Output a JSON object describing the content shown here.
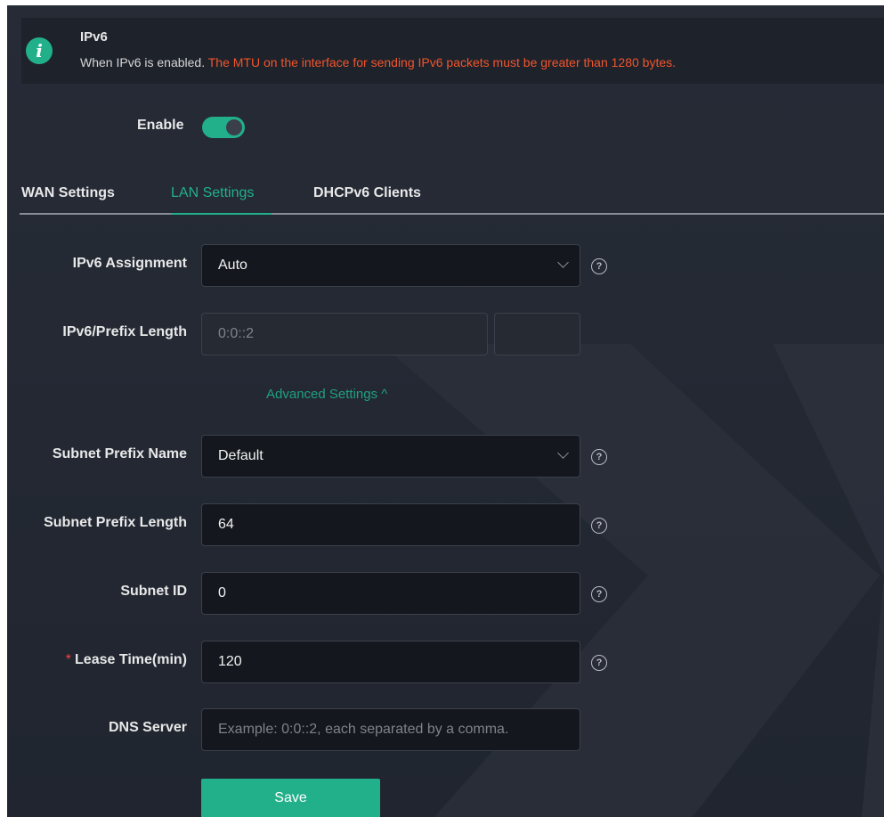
{
  "notice": {
    "title": "IPv6",
    "text_normal": "When IPv6 is enabled.",
    "text_warning": "The MTU on the interface for sending IPv6 packets must be greater than 1280 bytes.",
    "icon": "info-icon",
    "warning_color": "#f2552c"
  },
  "enable": {
    "label": "Enable",
    "state": true,
    "accent_color": "#22b08a"
  },
  "tabs": [
    {
      "label": "WAN Settings",
      "active": false
    },
    {
      "label": "LAN Settings",
      "active": true
    },
    {
      "label": "DHCPv6 Clients",
      "active": false
    }
  ],
  "form": {
    "ipv6_assignment": {
      "label": "IPv6 Assignment",
      "value": "Auto"
    },
    "prefix_length": {
      "label": "IPv6/Prefix Length",
      "address_value": "0:0::2",
      "length_value": ""
    },
    "advanced_toggle": {
      "label": "Advanced Settings",
      "glyph": "^"
    },
    "subnet_prefix_name": {
      "label": "Subnet Prefix Name",
      "value": "Default"
    },
    "subnet_prefix_length": {
      "label": "Subnet Prefix Length",
      "value": "64"
    },
    "subnet_id": {
      "label": "Subnet ID",
      "value": "0"
    },
    "lease_time": {
      "label": "Lease Time(min)",
      "value": "120",
      "required_mark": "*"
    },
    "dns_server": {
      "label": "DNS Server",
      "value": "",
      "placeholder": "Example: 0:0::2, each separated by a comma."
    },
    "help_glyph": "?"
  },
  "save_button": {
    "label": "Save"
  }
}
